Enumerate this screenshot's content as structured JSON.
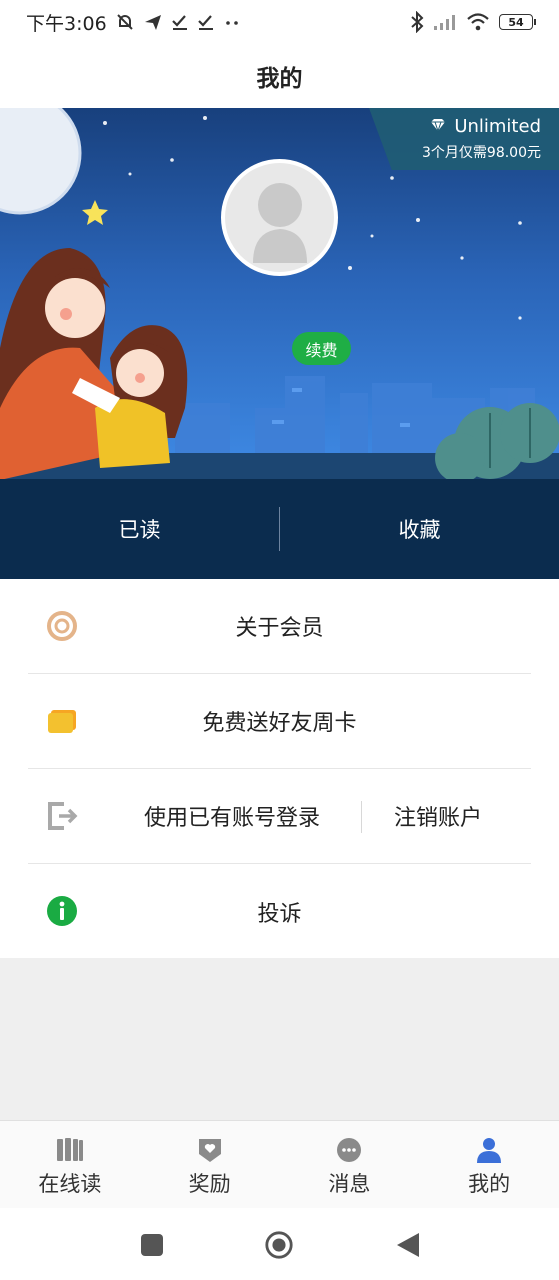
{
  "status_bar": {
    "time": "下午3:06",
    "battery": "54",
    "left_icons": [
      "mute-bell-icon",
      "send-icon",
      "check-icon",
      "check-icon",
      "dots-icon"
    ],
    "right_icons": [
      "bluetooth-icon",
      "signal-icon",
      "wifi-icon",
      "battery-icon"
    ]
  },
  "header": {
    "title": "我的"
  },
  "banner": {
    "vip_badge_title": "Unlimited",
    "vip_badge_subtitle": "3个月仅需98.00元",
    "renew_label": "续费"
  },
  "stats": {
    "read_label": "已读",
    "favorites_label": "收藏"
  },
  "menu": {
    "about_membership": "关于会员",
    "gift_week_card": "免费送好友周卡",
    "login_existing": "使用已有账号登录",
    "cancel_account": "注销账户",
    "complaint": "投诉"
  },
  "bottom_nav": {
    "items": [
      {
        "label": "在线读",
        "icon": "book-icon"
      },
      {
        "label": "奖励",
        "icon": "reward-badge-icon"
      },
      {
        "label": "消息",
        "icon": "chat-bubble-icon"
      },
      {
        "label": "我的",
        "icon": "user-icon"
      }
    ]
  },
  "colors": {
    "accent_blue": "#3b6fd8",
    "renew_green": "#1fae45",
    "stats_bg": "#0b2c4e",
    "info_green": "#1aab43",
    "card_yellow": "#f3c12f"
  }
}
